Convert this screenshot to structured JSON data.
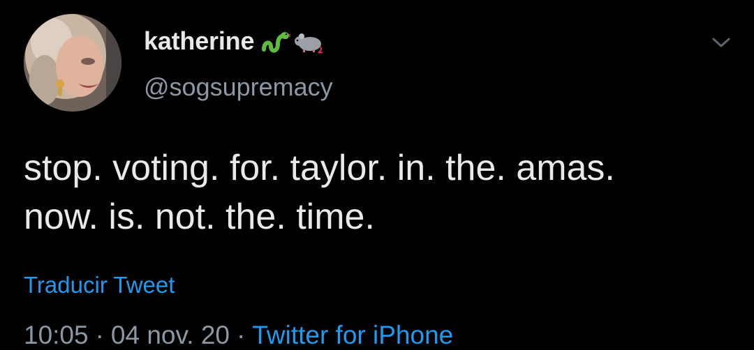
{
  "user": {
    "display_name": "katherine",
    "handle": "@sogsupremacy",
    "name_emojis": [
      "snake-emoji",
      "rat-emoji"
    ]
  },
  "tweet": {
    "lines": [
      "stop. voting. for. taylor. in. the. amas.",
      "now. is. not. the. time."
    ],
    "translate_label": "Traducir Tweet"
  },
  "meta": {
    "time": "10:05",
    "separator": "·",
    "date": "04 nov. 20",
    "source": "Twitter for iPhone"
  },
  "colors": {
    "background": "#000000",
    "text": "#e7e9ea",
    "muted": "#8b98a5",
    "accent": "#1d9bf0"
  },
  "icons": {
    "menu": "chevron-down-icon"
  }
}
